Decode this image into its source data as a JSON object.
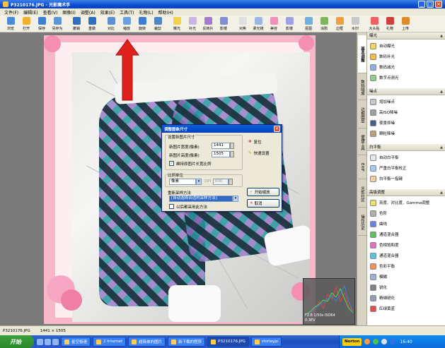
{
  "window": {
    "title": "P3210176.JPG - 光影魔术手"
  },
  "menu": [
    "文件(F)",
    "编辑(E)",
    "查看(V)",
    "图像(I)",
    "调整(A)",
    "效果(E)",
    "工具(T)",
    "礼物(L)",
    "帮助(H)"
  ],
  "toolbar": [
    {
      "label": "浏览",
      "color": "#4a8ad8"
    },
    {
      "label": "打开",
      "color": "#f0b030"
    },
    {
      "label": "保存",
      "color": "#3f7fd0"
    },
    {
      "label": "另存为",
      "color": "#5a96d8"
    },
    {
      "label": "撤销",
      "color": "#2f6fc0"
    },
    {
      "label": "重做",
      "color": "#2f6fc0"
    },
    {
      "label": "对比",
      "color": "#5d8fd5"
    },
    {
      "label": "缩放",
      "color": "#6aa0e0"
    },
    {
      "label": "旋转",
      "color": "#3c7dd0"
    },
    {
      "label": "裁剪",
      "color": "#4f86c9"
    },
    {
      "label": "曝光",
      "color": "#f2d24a"
    },
    {
      "label": "补光",
      "color": "#c9b5e8"
    },
    {
      "label": "反转片",
      "color": "#a37ad0"
    },
    {
      "label": "影楼",
      "color": "#7f8ed8"
    },
    {
      "label": "对焦",
      "color": "#e0e0e0"
    },
    {
      "label": "柔光镜",
      "color": "#9ab7e6"
    },
    {
      "label": "美容",
      "color": "#f08fb5"
    },
    {
      "label": "影楼",
      "color": "#a0a0e8"
    },
    {
      "label": "抠图",
      "color": "#6fb0e0"
    },
    {
      "label": "涂鸦",
      "color": "#7db85a"
    },
    {
      "label": "边框",
      "color": "#f0a040"
    },
    {
      "label": "水印",
      "color": "#c8c8c8"
    },
    {
      "label": "大头贴",
      "color": "#f06060"
    },
    {
      "label": "礼物",
      "color": "#d04040"
    },
    {
      "label": "上传",
      "color": "#e08a2a"
    }
  ],
  "dialog": {
    "title": "调整图象尺寸",
    "group_new_size": "设置新图片尺寸",
    "width_label": "新图片宽度(像素)",
    "width_value": "1441",
    "height_label": "新图片高度(像素)",
    "height_value": "1505",
    "keep_ratio": "维持原图片长宽比例",
    "reset": "复位",
    "quick_settings": "快速设置",
    "unit_group": "比例单位",
    "unit_value": "像素",
    "dpi_label": "DPI",
    "dpi_value": "600",
    "resample_label": "重新采样方法",
    "resample_value": "[自动选择合适的采样方法]",
    "always_use": "以后都采用此方法",
    "start": "开始缩放",
    "cancel": "取消"
  },
  "side_tabs": [
    "基本调整",
    "数码暗房",
    "边框图层",
    "便捷工具",
    "EXIF",
    "光影社区",
    "操作历史"
  ],
  "panel": {
    "sections": [
      {
        "title": "曝光",
        "items": [
          {
            "label": "自动曝光",
            "color": "#f4d35e"
          },
          {
            "label": "数码补光",
            "color": "#f9b84a"
          },
          {
            "label": "数码减光",
            "color": "#8ab2e0"
          },
          {
            "label": "数字点测光",
            "color": "#8fd08a"
          }
        ]
      },
      {
        "title": "噪点",
        "items": [
          {
            "label": "增加噪点",
            "color": "#c7c7c7"
          },
          {
            "label": "高ISO降噪",
            "color": "#9e9e9e"
          },
          {
            "label": "夜景抑噪",
            "color": "#4b5e8a"
          },
          {
            "label": "颗粒降噪",
            "color": "#b9a07a"
          }
        ]
      },
      {
        "title": "白平衡",
        "items": [
          {
            "label": "自动白平衡",
            "color": "#e8e8e8"
          },
          {
            "label": "严重白平衡校正",
            "color": "#a8c8f0"
          },
          {
            "label": "白平衡一指键",
            "color": "#f0d0a0"
          }
        ]
      },
      {
        "title": "高级调整",
        "items": [
          {
            "label": "亮度、对比度、Gamma调整",
            "color": "#e8e070"
          },
          {
            "label": "色阶",
            "color": "#b0b0b0"
          },
          {
            "label": "曲线",
            "color": "#7080e0"
          },
          {
            "label": "通道混合器",
            "color": "#60c060"
          },
          {
            "label": "色相饱和度",
            "color": "#e070c0"
          },
          {
            "label": "通道混合器",
            "color": "#60c0e0"
          },
          {
            "label": "色彩平衡",
            "color": "#f09060"
          },
          {
            "label": "模糊",
            "color": "#a0b0d0"
          },
          {
            "label": "锐化",
            "color": "#808080"
          },
          {
            "label": "精细锐化",
            "color": "#90a0b0"
          },
          {
            "label": "红绿黄蓝",
            "color": "#e05050"
          }
        ]
      }
    ]
  },
  "histogram": {
    "caption": "F2.8 1/50s ISO64",
    "sub": "0.3EV"
  },
  "status": {
    "file": "P3210176.JPG",
    "size": "1441 × 1505"
  },
  "taskbar": {
    "start": "开始",
    "tasks": [
      {
        "label": "星空极速"
      },
      {
        "label": "2 Internet"
      },
      {
        "label": "超简单的图片"
      },
      {
        "label": "新下载的程序"
      },
      {
        "label": "P3210176.JPG"
      },
      {
        "label": "shirleyjo"
      }
    ],
    "norton": "Norton",
    "clock": "16:40"
  }
}
